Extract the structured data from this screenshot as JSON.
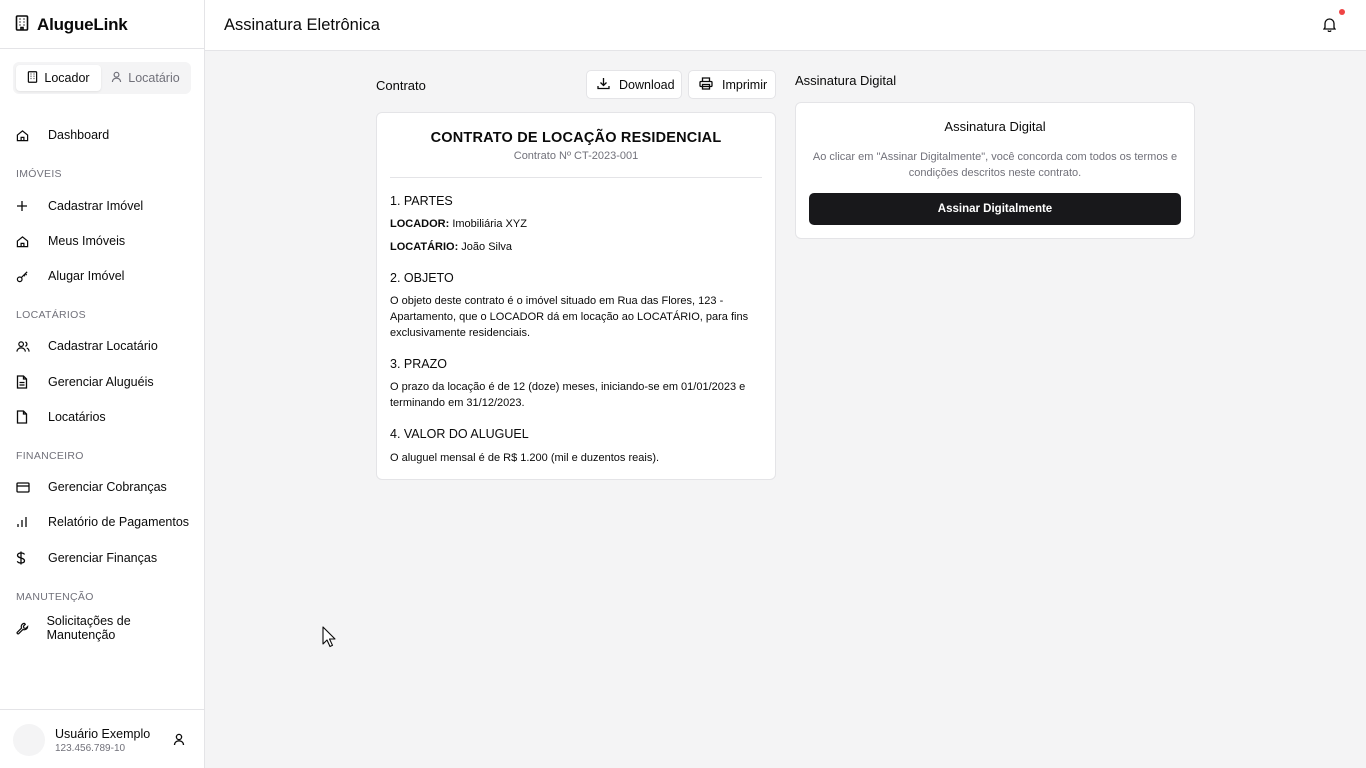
{
  "app": {
    "name": "AlugueLink"
  },
  "roles": [
    {
      "label": "Locador",
      "active": true,
      "icon": "building-icon"
    },
    {
      "label": "Locatário",
      "active": false,
      "icon": "user-icon"
    }
  ],
  "nav": {
    "dashboard": "Dashboard",
    "section_imoveis": "IMÓVEIS",
    "cadastrar_imovel": "Cadastrar Imóvel",
    "meus_imoveis": "Meus Imóveis",
    "alugar_imovel": "Alugar Imóvel",
    "section_locatarios": "LOCATÁRIOS",
    "cadastrar_locatario": "Cadastrar Locatário",
    "gerenciar_alugueis": "Gerenciar Aluguéis",
    "locatarios": "Locatários",
    "section_financeiro": "FINANCEIRO",
    "gerenciar_cobrancas": "Gerenciar Cobranças",
    "relatorio_pagamentos": "Relatório de Pagamentos",
    "gerenciar_financas": "Gerenciar Finanças",
    "section_manutencao": "MANUTENÇÃO",
    "solicitacoes_manutencao": "Solicitações de Manutenção"
  },
  "user": {
    "name": "Usuário Exemplo",
    "doc": "123.456.789-10"
  },
  "header": {
    "title": "Assinatura Eletrônica",
    "has_notification": true
  },
  "contract_section": {
    "label": "Contrato",
    "download_label": "Download",
    "print_label": "Imprimir"
  },
  "contract": {
    "title": "CONTRATO DE LOCAÇÃO RESIDENCIAL",
    "number": "Contrato Nº CT-2023-001",
    "s1_heading": "1. PARTES",
    "locador_label": "LOCADOR:",
    "locador_value": " Imobiliária XYZ",
    "locatario_label": "LOCATÁRIO:",
    "locatario_value": " João Silva",
    "s2_heading": "2. OBJETO",
    "s2_text": "O objeto deste contrato é o imóvel situado em Rua das Flores, 123 - Apartamento, que o LOCADOR dá em locação ao LOCATÁRIO, para fins exclusivamente residenciais.",
    "s3_heading": "3. PRAZO",
    "s3_text": "O prazo da locação é de 12 (doze) meses, iniciando-se em 01/01/2023 e terminando em 31/12/2023.",
    "s4_heading": "4. VALOR DO ALUGUEL",
    "s4_text": "O aluguel mensal é de R$ 1.200 (mil e duzentos reais)."
  },
  "signature": {
    "section_label": "Assinatura Digital",
    "card_title": "Assinatura Digital",
    "description": "Ao clicar em \"Assinar Digitalmente\", você concorda com todos os termos e condições descritos neste contrato.",
    "button_label": "Assinar Digitalmente"
  },
  "colors": {
    "primary": "#18181b",
    "muted_text": "#71717a",
    "border": "#e4e4e7",
    "background": "#f4f4f5",
    "notification_dot": "#ef4444"
  }
}
